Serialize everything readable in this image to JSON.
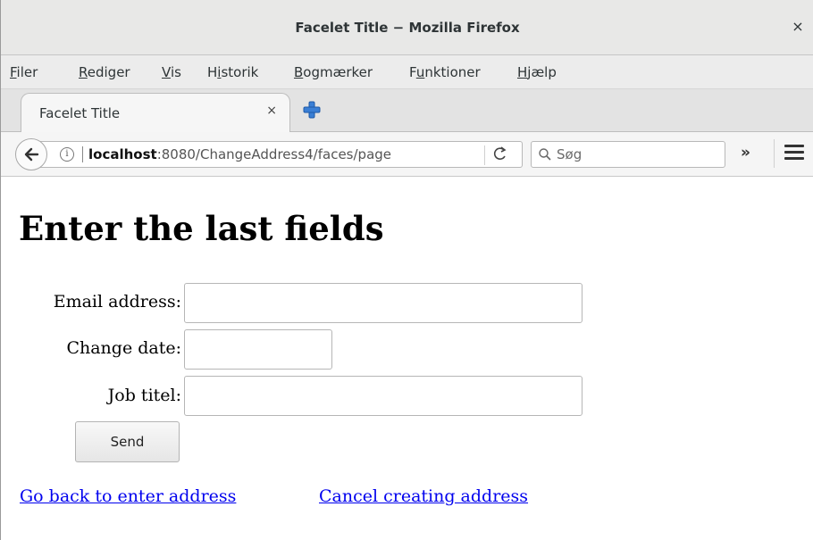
{
  "window": {
    "title": "Facelet Title − Mozilla Firefox",
    "close_glyph": "×"
  },
  "menubar": {
    "items": [
      {
        "acc": "F",
        "rest": "iler"
      },
      {
        "acc": "R",
        "rest": "ediger"
      },
      {
        "acc": "V",
        "rest": "is"
      },
      {
        "pre": "H",
        "acc": "i",
        "rest": "storik"
      },
      {
        "acc": "B",
        "rest": "ogmærker"
      },
      {
        "pre": "F",
        "acc": "u",
        "rest": "nktioner"
      },
      {
        "acc": "H",
        "rest": "jælp"
      }
    ]
  },
  "tabs": [
    {
      "label": "Facelet Title",
      "close_glyph": "×"
    }
  ],
  "navbar": {
    "url_host": "localhost",
    "url_rest": ":8080/ChangeAddress4/faces/page",
    "search_placeholder": "Søg",
    "overflow_glyph": "»",
    "reload_glyph": "C",
    "info_glyph": "i"
  },
  "page": {
    "heading": "Enter the last fields",
    "form": {
      "email_label": "Email address:",
      "email_value": "",
      "date_label": "Change date:",
      "date_value": "",
      "job_label": "Job titel:",
      "job_value": "",
      "send_label": "Send"
    },
    "links": {
      "back": "Go back to enter address",
      "cancel": "Cancel creating address"
    }
  },
  "colors": {
    "link": "#0000ee",
    "titlebar": "#e8e8e7",
    "newtab_icon": "#3a7fd5"
  },
  "icons": [
    "close-icon",
    "new-tab-icon",
    "back-arrow-icon",
    "info-icon",
    "reload-icon",
    "search-icon",
    "overflow-chevron-icon",
    "hamburger-menu-icon"
  ]
}
